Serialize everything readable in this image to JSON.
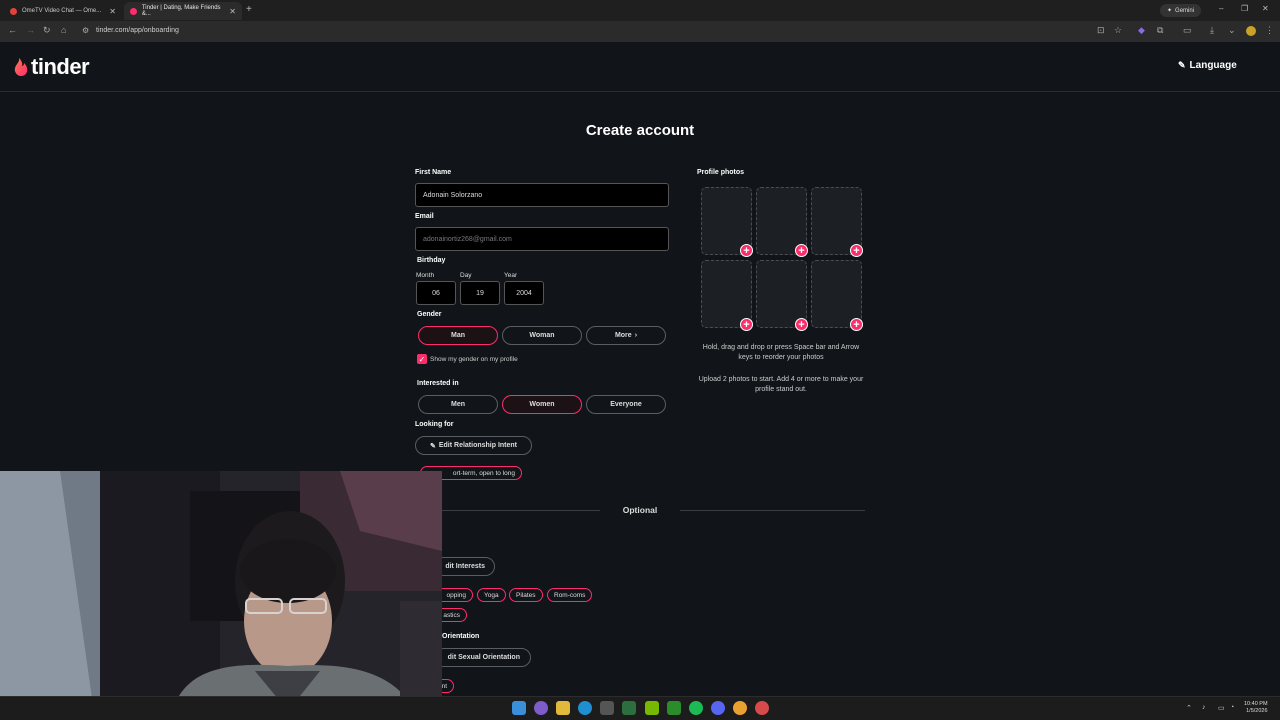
{
  "browser": {
    "tabs": [
      {
        "title": "OmeTV Video Chat — Ome...",
        "active": false
      },
      {
        "title": "Tinder | Dating, Make Friends &...",
        "active": true
      }
    ],
    "new_tab": "+",
    "gemini_label": "Gemini",
    "url": "tinder.com/app/onboarding",
    "window_controls": [
      "–",
      "❐",
      "✕"
    ]
  },
  "header": {
    "logo_text": "tinder",
    "language_label": "Language"
  },
  "form": {
    "title": "Create account",
    "first_name": {
      "label": "First Name",
      "value": "Adonain Solorzano"
    },
    "email": {
      "label": "Email",
      "placeholder": "adonainortiz268@gmail.com"
    },
    "birthday": {
      "label": "Birthday",
      "month_label": "Month",
      "month_value": "06",
      "day_label": "Day",
      "day_value": "19",
      "year_label": "Year",
      "year_value": "2004"
    },
    "gender": {
      "label": "Gender",
      "options": [
        "Man",
        "Woman",
        "More"
      ],
      "selected": "Man",
      "show_on_profile": "Show my gender on my profile"
    },
    "interested_in": {
      "label": "Interested in",
      "options": [
        "Men",
        "Women",
        "Everyone"
      ],
      "selected": "Women"
    },
    "looking_for": {
      "label": "Looking for",
      "edit_button": "Edit Relationship Intent",
      "chip": "ort-term, open to long"
    },
    "optional_label": "Optional",
    "interests": {
      "label": "s",
      "edit_button": "dit Interests",
      "chips": [
        "opping",
        "Yoga",
        "Pilates",
        "Rom-coms",
        "astics"
      ]
    },
    "orientation": {
      "label": "Orientation",
      "edit_button": "dit Sexual Orientation",
      "chip": "nt"
    }
  },
  "photos": {
    "label": "Profile photos",
    "slots": 6,
    "hint1": "Hold, drag and drop or press Space bar and Arrow keys to reorder your photos",
    "hint2": "Upload 2 photos to start. Add 4 or more to make your profile stand out."
  },
  "taskbar": {
    "time": "10:40 PM",
    "date": "1/5/2026"
  },
  "colors": {
    "accent": "#fd2d6b",
    "background": "#111418"
  }
}
